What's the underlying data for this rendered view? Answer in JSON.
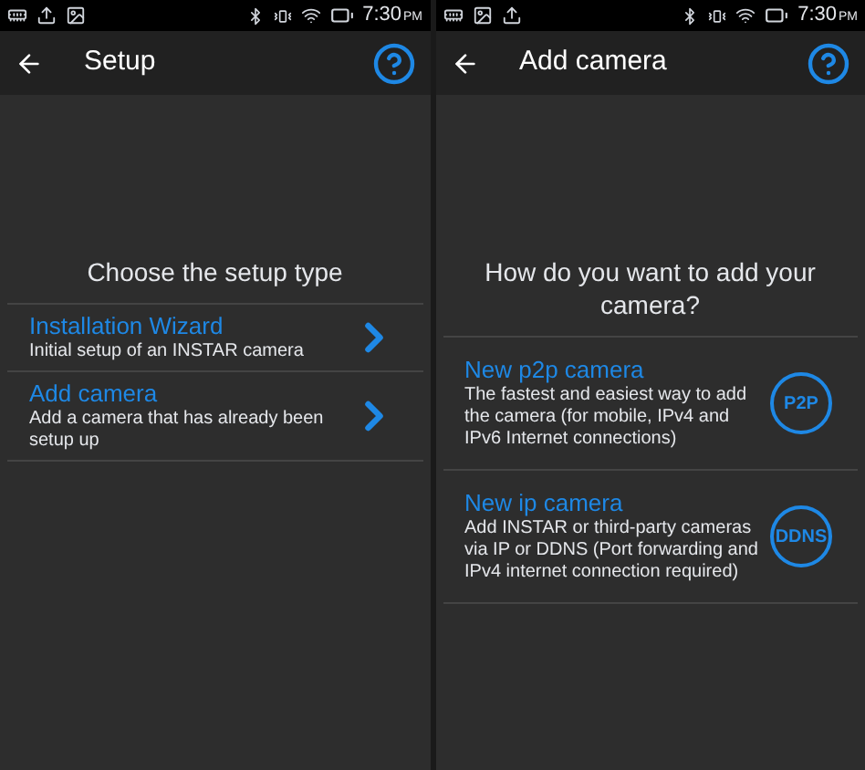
{
  "screens": [
    {
      "status_bar": {
        "notification_icons": [
          {
            "kind": "sd"
          },
          {
            "kind": "upload"
          },
          {
            "kind": "image"
          }
        ],
        "time": "7:30",
        "ampm": "PM"
      },
      "app_bar": {
        "title": "Setup"
      },
      "heading": "Choose the setup type",
      "options": [
        {
          "title": "Installation Wizard",
          "description": "Initial setup of an INSTAR camera",
          "trailing": {
            "kind": "chevron"
          }
        },
        {
          "title": "Add camera",
          "description": "Add a camera that has already been setup up",
          "trailing": {
            "kind": "chevron"
          }
        }
      ]
    },
    {
      "status_bar": {
        "notification_icons": [
          {
            "kind": "sd"
          },
          {
            "kind": "image"
          },
          {
            "kind": "upload"
          }
        ],
        "time": "7:30",
        "ampm": "PM"
      },
      "app_bar": {
        "title": "Add camera"
      },
      "heading": "How do you want to add your camera?",
      "options": [
        {
          "title": "New p2p camera",
          "description": "The fastest and easiest way to add the camera (for mobile, IPv4 and IPv6 Internet connections)",
          "trailing": {
            "kind": "badge",
            "label": "P2P"
          }
        },
        {
          "title": "New ip camera",
          "description": "Add INSTAR or third-party cameras via IP or DDNS (Port forwarding and IPv4 internet connection required)",
          "trailing": {
            "kind": "badge",
            "label": "DDNS"
          }
        }
      ]
    }
  ]
}
